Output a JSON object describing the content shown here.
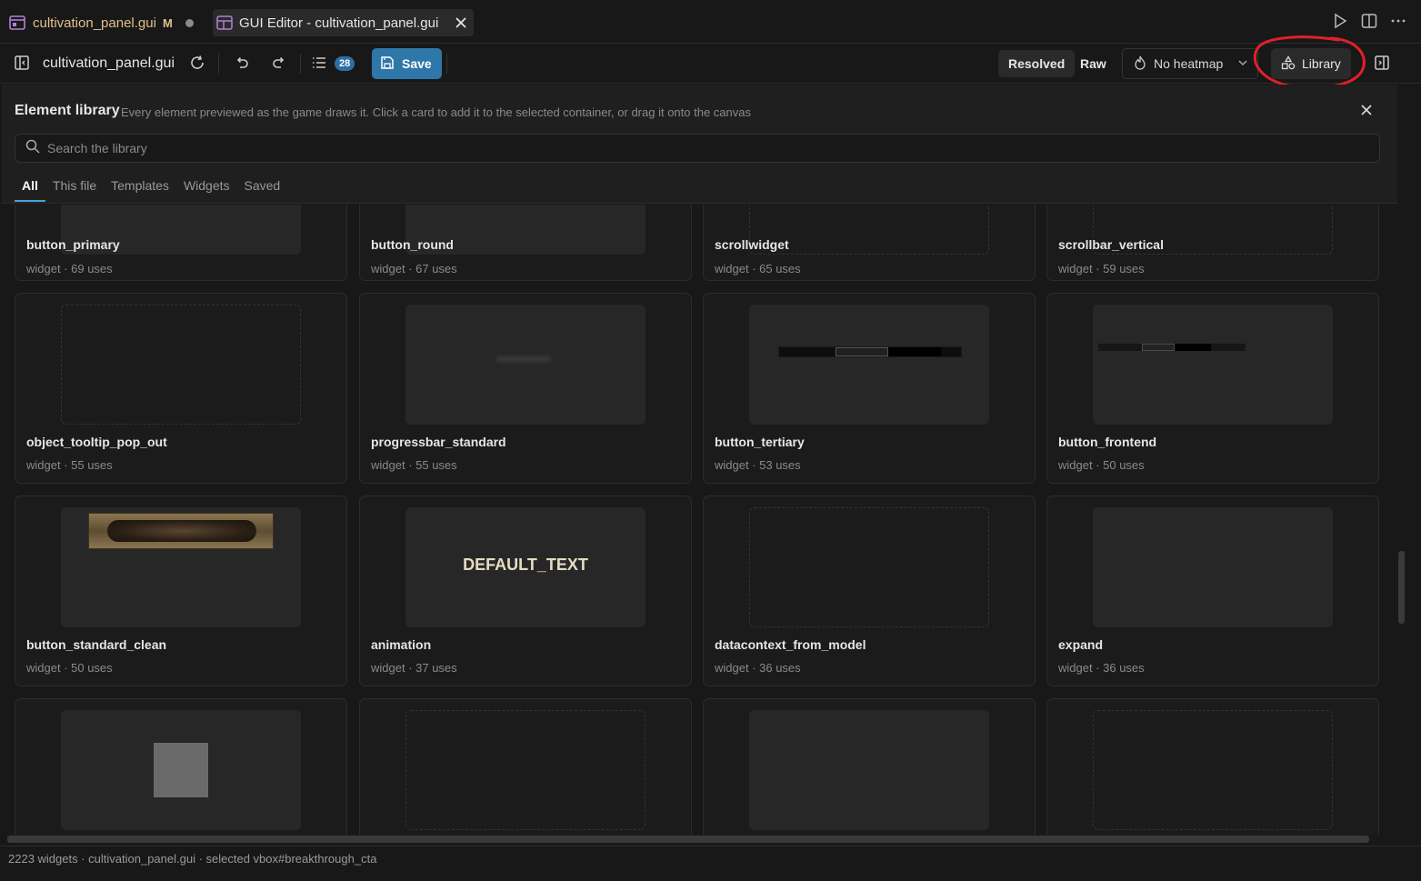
{
  "tabs": [
    {
      "label": "cultivation_panel.gui",
      "modified_flag": "M"
    },
    {
      "label": "GUI Editor - cultivation_panel.gui"
    }
  ],
  "toolbar": {
    "filename": "cultivation_panel.gui",
    "issues_count": "28",
    "save_label": "Save",
    "resolved_label": "Resolved",
    "raw_label": "Raw",
    "heatmap_value": "No heatmap",
    "library_label": "Library"
  },
  "library": {
    "title": "Element library",
    "description": "Every element previewed as the game draws it. Click a card to add it to the selected container, or drag it onto the canvas",
    "search_placeholder": "Search the library",
    "filters": [
      "All",
      "This file",
      "Templates",
      "Widgets",
      "Saved"
    ],
    "cards": [
      {
        "name": "button_primary",
        "meta": "widget · 69 uses"
      },
      {
        "name": "button_round",
        "meta": "widget · 67 uses"
      },
      {
        "name": "scrollwidget",
        "meta": "widget · 65 uses"
      },
      {
        "name": "scrollbar_vertical",
        "meta": "widget · 59 uses"
      },
      {
        "name": "object_tooltip_pop_out",
        "meta": "widget · 55 uses"
      },
      {
        "name": "progressbar_standard",
        "meta": "widget · 55 uses"
      },
      {
        "name": "button_tertiary",
        "meta": "widget · 53 uses"
      },
      {
        "name": "button_frontend",
        "meta": "widget · 50 uses"
      },
      {
        "name": "button_standard_clean",
        "meta": "widget · 50 uses"
      },
      {
        "name": "animation",
        "meta": "widget · 37 uses",
        "preview_text": "DEFAULT_TEXT"
      },
      {
        "name": "datacontext_from_model",
        "meta": "widget · 36 uses"
      },
      {
        "name": "expand",
        "meta": "widget · 36 uses"
      }
    ]
  },
  "status": {
    "text": "2223 widgets · cultivation_panel.gui · selected vbox#breakthrough_cta"
  },
  "colors": {
    "accent": "#2f77a8",
    "modified": "#e2c08d",
    "annotation": "#e0202a"
  }
}
